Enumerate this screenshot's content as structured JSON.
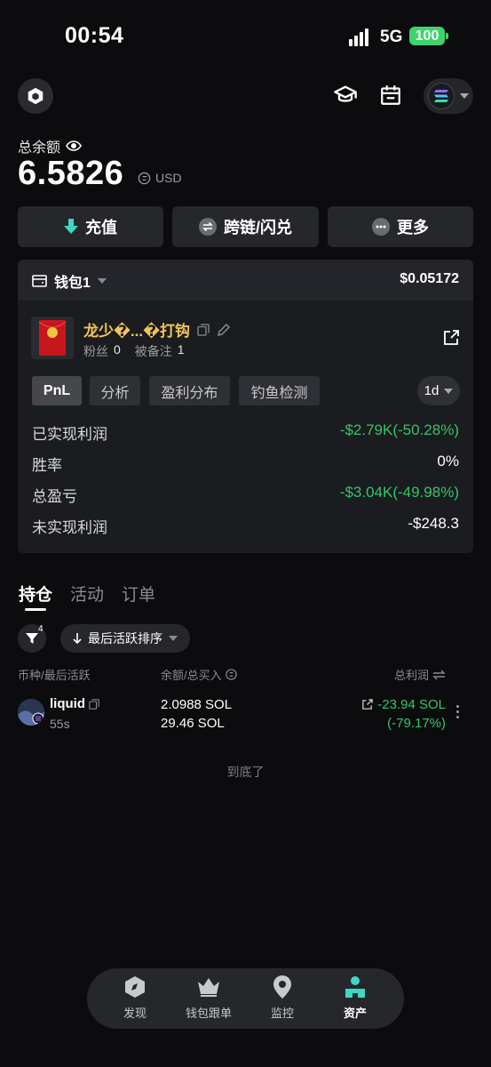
{
  "status_bar": {
    "time": "00:54",
    "network": "5G",
    "battery": "100"
  },
  "colors": {
    "background": "#0c0c0e",
    "positive_green": "#35c46a",
    "accent_gold": "#f2c45a",
    "battery_green": "#3ed36b"
  },
  "header": {
    "icons": [
      "app-logo-icon",
      "graduation-cap-icon",
      "calendar-icon",
      "solana-chain-icon"
    ]
  },
  "balance": {
    "label": "总余额",
    "value": "6.5826",
    "currency": "USD"
  },
  "actions": [
    {
      "label": "充值",
      "icon": "deposit-arrow-icon"
    },
    {
      "label": "跨链/闪兑",
      "icon": "bridge-swap-icon"
    },
    {
      "label": "更多",
      "icon": "more-dots-icon"
    }
  ],
  "wallet": {
    "name": "钱包1",
    "amount": "$0.05172",
    "user": {
      "name": "龙少�...�打钩",
      "fans_label": "粉丝",
      "fans_count": "0",
      "noted_label": "被备注",
      "noted_count": "1"
    },
    "tabs": [
      "PnL",
      "分析",
      "盈利分布",
      "钓鱼检测"
    ],
    "active_tab": "PnL",
    "range": "1d",
    "stats": [
      {
        "label": "已实现利润",
        "value": "-$2.79K(-50.28%)",
        "color": "green"
      },
      {
        "label": "胜率",
        "value": "0%",
        "color": "white"
      },
      {
        "label": "总盈亏",
        "value": "-$3.04K(-49.98%)",
        "color": "green"
      },
      {
        "label": "未实现利润",
        "value": "-$248.3",
        "color": "white"
      }
    ]
  },
  "holdings": {
    "tabs": [
      "持仓",
      "活动",
      "订单"
    ],
    "active_tab": "持仓",
    "filter_count": "4",
    "sort_label": "最后活跃排序",
    "columns": {
      "token": "币种/最后活跃",
      "balance": "余额/总买入",
      "pnl": "总利润"
    },
    "rows": [
      {
        "name": "liquid",
        "last_active": "55s",
        "balance": "2.0988 SOL",
        "total_buy": "29.46 SOL",
        "pnl": "-23.94 SOL",
        "pnl_pct": "(-79.17%)"
      }
    ],
    "end_text": "到底了"
  },
  "bottom_nav": {
    "items": [
      {
        "label": "发现",
        "icon": "compass-icon"
      },
      {
        "label": "钱包跟单",
        "icon": "crown-icon"
      },
      {
        "label": "监控",
        "icon": "location-pin-icon"
      },
      {
        "label": "资产",
        "icon": "assets-icon"
      }
    ],
    "active": "资产"
  }
}
